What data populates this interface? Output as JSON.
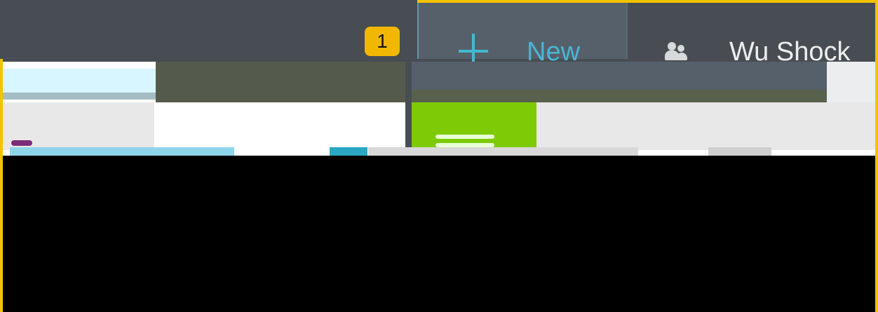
{
  "topbar": {
    "notification_count": "1",
    "new_label": "New",
    "user_name": "Wu Shock"
  },
  "icons": {
    "new": "plus-icon",
    "user": "users-icon",
    "card": "card-icon"
  },
  "colors": {
    "accent_yellow": "#f3c300",
    "topbar_bg": "#474d53",
    "new_seg_bg": "#56606a",
    "new_text": "#49b5d3",
    "green_card": "#7ecb05",
    "lower_black": "#000000"
  }
}
